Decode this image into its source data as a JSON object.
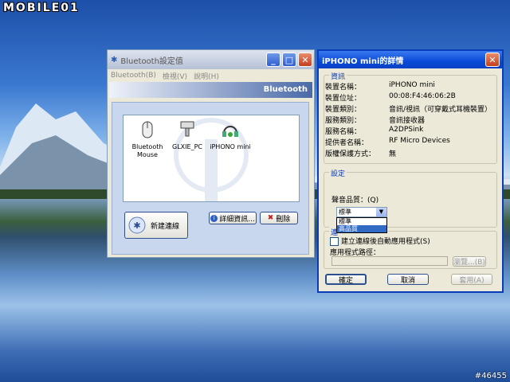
{
  "watermark": {
    "logo": "MOBILE01",
    "id": "#46455"
  },
  "bt_window": {
    "title": "Bluetooth設定值",
    "menu": [
      "Bluetooth(B)",
      "檢視(V)",
      "說明(H)"
    ],
    "brand": "Bluetooth",
    "devices": [
      {
        "name": "Bluetooth Mouse",
        "icon": "mouse-icon"
      },
      {
        "name": "GLXIE_PC",
        "icon": "computer-icon"
      },
      {
        "name": "iPHONO mini",
        "icon": "headphones-icon"
      }
    ],
    "new_connection": "新建連線",
    "details_button": "詳細資訊...",
    "delete_button": "刪除"
  },
  "details_window": {
    "title": "iPHONO mini的詳情",
    "info_caption": "資訊",
    "info": [
      {
        "label": "裝置名稱：",
        "value": "iPHONO mini"
      },
      {
        "label": "裝置位址：",
        "value": "00:08:F4:46:06:2B"
      },
      {
        "label": "裝置類別：",
        "value": "音訊/視訊（可穿戴式耳機裝置）"
      },
      {
        "label": "服務類別：",
        "value": "音訊接收器"
      },
      {
        "label": "服務名稱：",
        "value": "A2DPSink"
      },
      {
        "label": "提供者名稱：",
        "value": "RF Micro Devices"
      },
      {
        "label": "版權保護方式：",
        "value": "無"
      }
    ],
    "settings_caption": "設定",
    "quality_label": "聲音品質：(Q)",
    "quality_selected": "標準",
    "quality_options": [
      "標準",
      "高品質"
    ],
    "connect_caption": "連",
    "autostart_label": "建立連線後自動應用程式(S)",
    "path_label": "應用程式路徑：",
    "browse_button": "瀏覽...(B)",
    "ok_button": "確定",
    "cancel_button": "取消",
    "apply_button": "套用(A)"
  }
}
